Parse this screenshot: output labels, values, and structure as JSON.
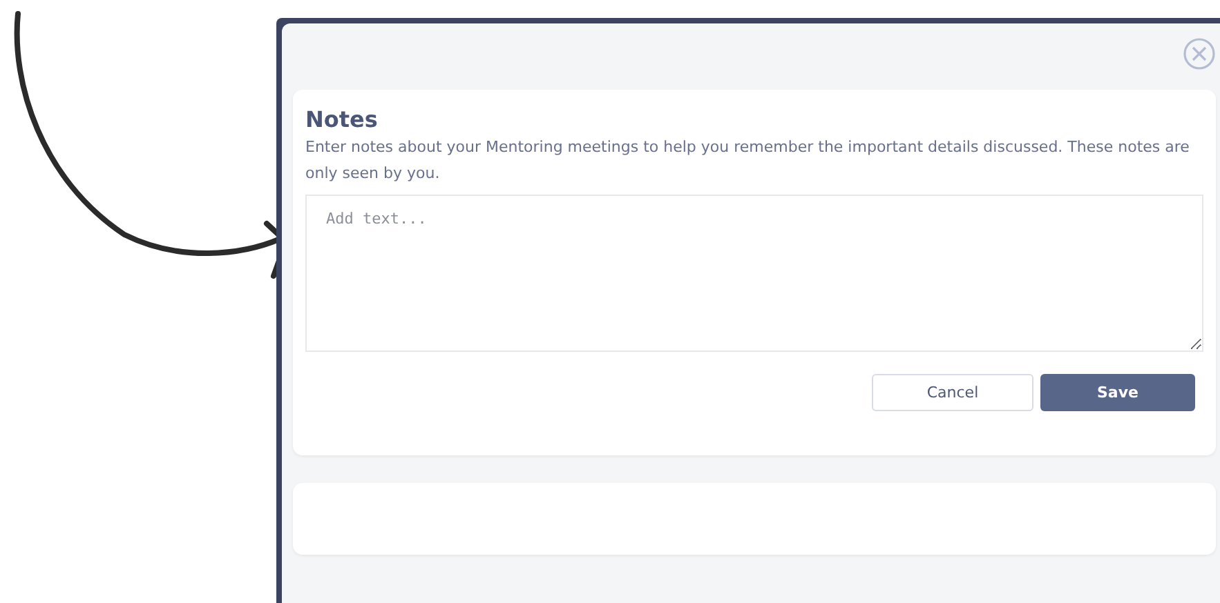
{
  "dialog": {
    "title": "Notes",
    "description": "Enter notes about your Mentoring meetings to help you remember the important details discussed. These notes are only seen by you.",
    "notes_field": {
      "placeholder": "Add text..."
    },
    "buttons": [
      {
        "label": "Cancel",
        "kind": "secondary"
      },
      {
        "label": "Save",
        "kind": "primary"
      }
    ]
  }
}
